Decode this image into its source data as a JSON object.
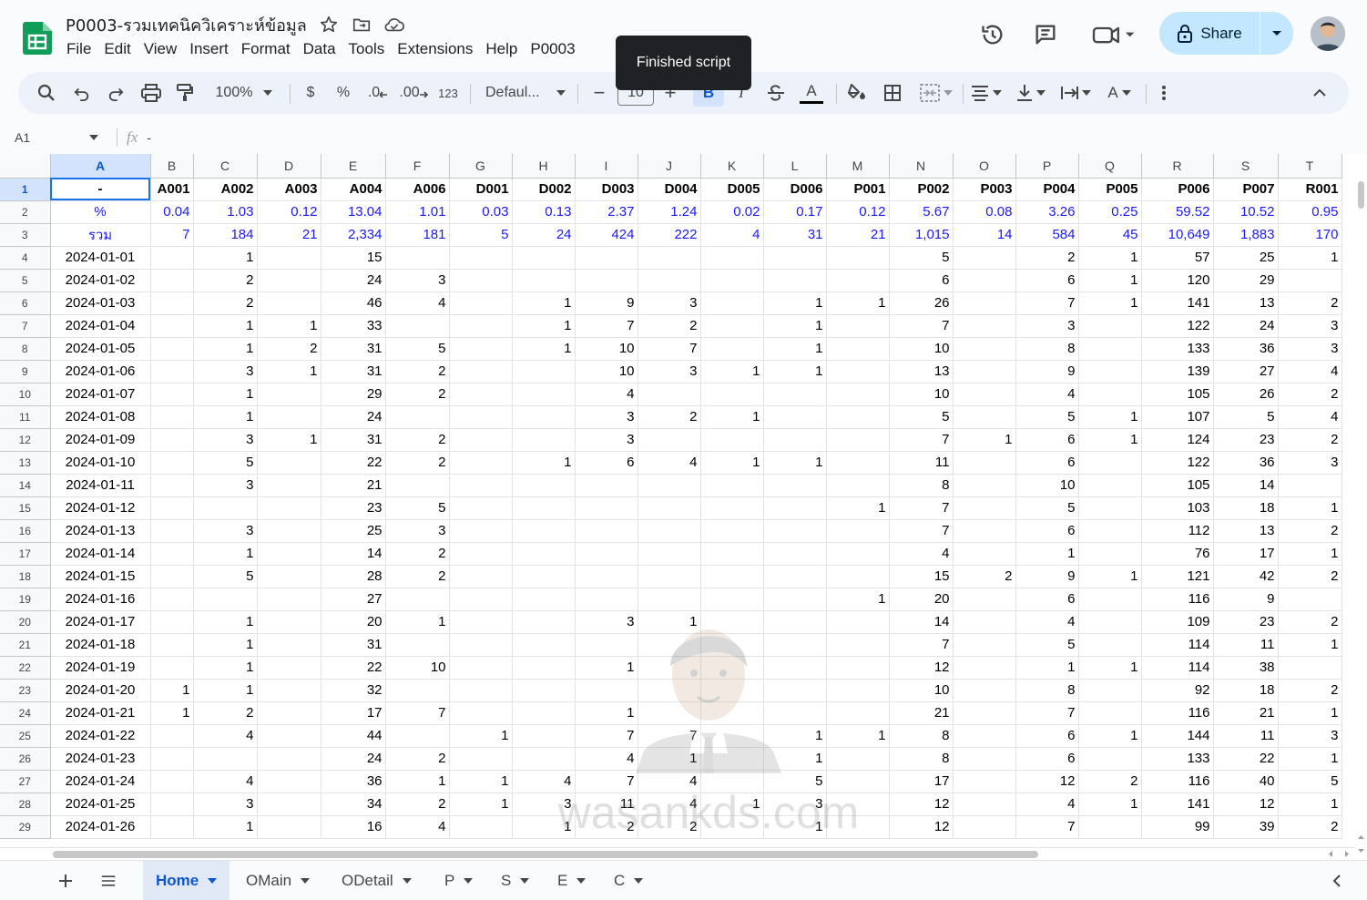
{
  "header": {
    "doc_title": "P0003-รวมเทคนิควิเคราะห์ข้อมูล",
    "menu": [
      "File",
      "Edit",
      "View",
      "Insert",
      "Format",
      "Data",
      "Tools",
      "Extensions",
      "Help",
      "P0003"
    ],
    "share_label": "Share",
    "tooltip": "Finished script"
  },
  "toolbar": {
    "zoom": "100%",
    "currency": "$",
    "percent": "%",
    "dec_decrease": ".0",
    "dec_increase": ".00",
    "number_format": "123",
    "font": "Defaul...",
    "font_size": "10",
    "bold": "B",
    "italic": "I",
    "text_color": "A",
    "text_rotate": "A"
  },
  "formula_bar": {
    "cell_ref": "A1",
    "fx": "fx",
    "content": "-"
  },
  "grid": {
    "columns": [
      "A",
      "B",
      "C",
      "D",
      "E",
      "F",
      "G",
      "H",
      "I",
      "J",
      "K",
      "L",
      "M",
      "N",
      "O",
      "P",
      "Q",
      "R",
      "S",
      "T"
    ],
    "row_numbers": [
      "1",
      "2",
      "3",
      "4",
      "5",
      "6",
      "7",
      "8",
      "9",
      "10",
      "11",
      "12",
      "13",
      "14",
      "15",
      "16",
      "17",
      "18",
      "19",
      "20",
      "21",
      "22",
      "23",
      "24",
      "25",
      "26",
      "27",
      "28",
      "29"
    ],
    "header_row": [
      "-",
      "A001",
      "A002",
      "A003",
      "A004",
      "A006",
      "D001",
      "D002",
      "D003",
      "D004",
      "D005",
      "D006",
      "P001",
      "P002",
      "P003",
      "P004",
      "P005",
      "P006",
      "P007",
      "R001"
    ],
    "percent_row": [
      "%",
      "0.04",
      "1.03",
      "0.12",
      "13.04",
      "1.01",
      "0.03",
      "0.13",
      "2.37",
      "1.24",
      "0.02",
      "0.17",
      "0.12",
      "5.67",
      "0.08",
      "3.26",
      "0.25",
      "59.52",
      "10.52",
      "0.95"
    ],
    "total_row": [
      "รวม",
      "7",
      "184",
      "21",
      "2,334",
      "181",
      "5",
      "24",
      "424",
      "222",
      "4",
      "31",
      "21",
      "1,015",
      "14",
      "584",
      "45",
      "10,649",
      "1,883",
      "170"
    ],
    "data_rows": [
      [
        "2024-01-01",
        "",
        "1",
        "",
        "15",
        "",
        "",
        "",
        "",
        "",
        "",
        "",
        "",
        "5",
        "",
        "2",
        "1",
        "57",
        "25",
        "1"
      ],
      [
        "2024-01-02",
        "",
        "2",
        "",
        "24",
        "3",
        "",
        "",
        "",
        "",
        "",
        "",
        "",
        "6",
        "",
        "6",
        "1",
        "120",
        "29",
        ""
      ],
      [
        "2024-01-03",
        "",
        "2",
        "",
        "46",
        "4",
        "",
        "1",
        "9",
        "3",
        "",
        "1",
        "1",
        "26",
        "",
        "7",
        "1",
        "141",
        "13",
        "2"
      ],
      [
        "2024-01-04",
        "",
        "1",
        "1",
        "33",
        "",
        "",
        "1",
        "7",
        "2",
        "",
        "1",
        "",
        "7",
        "",
        "3",
        "",
        "122",
        "24",
        "3"
      ],
      [
        "2024-01-05",
        "",
        "1",
        "2",
        "31",
        "5",
        "",
        "1",
        "10",
        "7",
        "",
        "1",
        "",
        "10",
        "",
        "8",
        "",
        "133",
        "36",
        "3"
      ],
      [
        "2024-01-06",
        "",
        "3",
        "1",
        "31",
        "2",
        "",
        "",
        "10",
        "3",
        "1",
        "1",
        "",
        "13",
        "",
        "9",
        "",
        "139",
        "27",
        "4"
      ],
      [
        "2024-01-07",
        "",
        "1",
        "",
        "29",
        "2",
        "",
        "",
        "4",
        "",
        "",
        "",
        "",
        "10",
        "",
        "4",
        "",
        "105",
        "26",
        "2"
      ],
      [
        "2024-01-08",
        "",
        "1",
        "",
        "24",
        "",
        "",
        "",
        "3",
        "2",
        "1",
        "",
        "",
        "5",
        "",
        "5",
        "1",
        "107",
        "5",
        "4"
      ],
      [
        "2024-01-09",
        "",
        "3",
        "1",
        "31",
        "2",
        "",
        "",
        "3",
        "",
        "",
        "",
        "",
        "7",
        "1",
        "6",
        "1",
        "124",
        "23",
        "2"
      ],
      [
        "2024-01-10",
        "",
        "5",
        "",
        "22",
        "2",
        "",
        "1",
        "6",
        "4",
        "1",
        "1",
        "",
        "11",
        "",
        "6",
        "",
        "122",
        "36",
        "3"
      ],
      [
        "2024-01-11",
        "",
        "3",
        "",
        "21",
        "",
        "",
        "",
        "",
        "",
        "",
        "",
        "",
        "8",
        "",
        "10",
        "",
        "105",
        "14",
        ""
      ],
      [
        "2024-01-12",
        "",
        "",
        "",
        "23",
        "5",
        "",
        "",
        "",
        "",
        "",
        "",
        "1",
        "7",
        "",
        "5",
        "",
        "103",
        "18",
        "1"
      ],
      [
        "2024-01-13",
        "",
        "3",
        "",
        "25",
        "3",
        "",
        "",
        "",
        "",
        "",
        "",
        "",
        "7",
        "",
        "6",
        "",
        "112",
        "13",
        "2"
      ],
      [
        "2024-01-14",
        "",
        "1",
        "",
        "14",
        "2",
        "",
        "",
        "",
        "",
        "",
        "",
        "",
        "4",
        "",
        "1",
        "",
        "76",
        "17",
        "1"
      ],
      [
        "2024-01-15",
        "",
        "5",
        "",
        "28",
        "2",
        "",
        "",
        "",
        "",
        "",
        "",
        "",
        "15",
        "2",
        "9",
        "1",
        "121",
        "42",
        "2"
      ],
      [
        "2024-01-16",
        "",
        "",
        "",
        "27",
        "",
        "",
        "",
        "",
        "",
        "",
        "",
        "1",
        "20",
        "",
        "6",
        "",
        "116",
        "9",
        ""
      ],
      [
        "2024-01-17",
        "",
        "1",
        "",
        "20",
        "1",
        "",
        "",
        "3",
        "1",
        "",
        "",
        "",
        "14",
        "",
        "4",
        "",
        "109",
        "23",
        "2"
      ],
      [
        "2024-01-18",
        "",
        "1",
        "",
        "31",
        "",
        "",
        "",
        "",
        "",
        "",
        "",
        "",
        "7",
        "",
        "5",
        "",
        "114",
        "11",
        "1"
      ],
      [
        "2024-01-19",
        "",
        "1",
        "",
        "22",
        "10",
        "",
        "",
        "1",
        "",
        "",
        "",
        "",
        "12",
        "",
        "1",
        "1",
        "114",
        "38",
        ""
      ],
      [
        "2024-01-20",
        "1",
        "1",
        "",
        "32",
        "",
        "",
        "",
        "",
        "",
        "",
        "",
        "",
        "10",
        "",
        "8",
        "",
        "92",
        "18",
        "2"
      ],
      [
        "2024-01-21",
        "1",
        "2",
        "",
        "17",
        "7",
        "",
        "",
        "1",
        "",
        "",
        "",
        "",
        "21",
        "",
        "7",
        "",
        "116",
        "21",
        "1"
      ],
      [
        "2024-01-22",
        "",
        "4",
        "",
        "44",
        "",
        "1",
        "",
        "7",
        "7",
        "",
        "1",
        "1",
        "8",
        "",
        "6",
        "1",
        "144",
        "11",
        "3"
      ],
      [
        "2024-01-23",
        "",
        "",
        "",
        "24",
        "2",
        "",
        "",
        "4",
        "1",
        "",
        "1",
        "",
        "8",
        "",
        "6",
        "",
        "133",
        "22",
        "1"
      ],
      [
        "2024-01-24",
        "",
        "4",
        "",
        "36",
        "1",
        "1",
        "4",
        "7",
        "4",
        "",
        "5",
        "",
        "17",
        "",
        "12",
        "2",
        "116",
        "40",
        "5"
      ],
      [
        "2024-01-25",
        "",
        "3",
        "",
        "34",
        "2",
        "1",
        "3",
        "11",
        "4",
        "1",
        "3",
        "",
        "12",
        "",
        "4",
        "1",
        "141",
        "12",
        "1"
      ],
      [
        "2024-01-26",
        "",
        "1",
        "",
        "16",
        "4",
        "",
        "1",
        "2",
        "2",
        "",
        "1",
        "",
        "12",
        "",
        "7",
        "",
        "99",
        "39",
        "2"
      ]
    ]
  },
  "sheets": [
    "Home",
    "OMain",
    "ODetail",
    "P",
    "S",
    "E",
    "C"
  ],
  "watermark": "wasankds.com",
  "colors": {
    "accent_blue": "#0b57d0",
    "share_bg": "#c2e7ff",
    "value_blue": "#1a1aff"
  }
}
